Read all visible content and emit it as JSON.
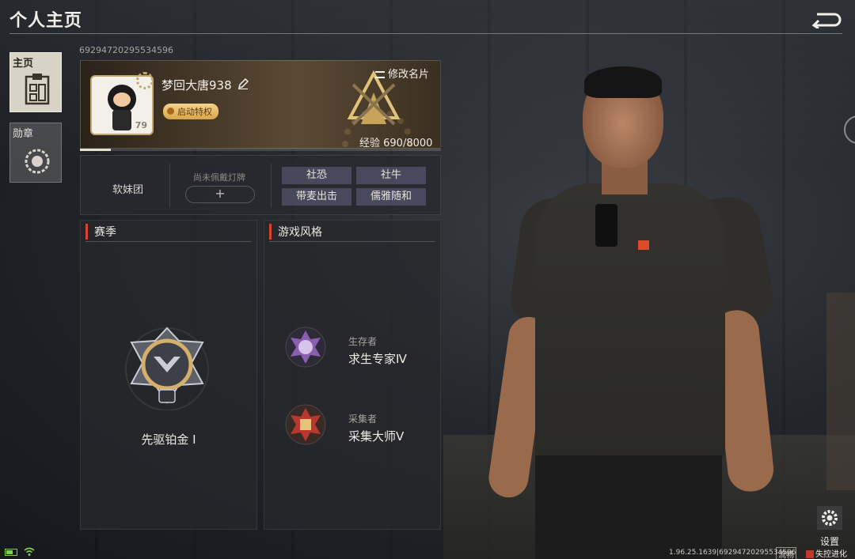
{
  "header": {
    "title": "个人主页"
  },
  "tabs": [
    {
      "label": "主页",
      "active": true
    },
    {
      "label": "勋章",
      "active": false
    }
  ],
  "profile": {
    "uid": "69294720295534596",
    "nickname": "梦回大唐938",
    "avatar_level": "79",
    "privilege_label": "启动特权",
    "edit_card_label": "修改名片",
    "exp_text": "经验 690/8000",
    "exp_current": 690,
    "exp_max": 8000
  },
  "tags_row": {
    "team": "软妹团",
    "lamp_label": "尚未佩戴灯牌",
    "lamp_add": "+",
    "tags": [
      "社恐",
      "社牛",
      "带麦出击",
      "儒雅随和"
    ]
  },
  "season": {
    "title": "赛季",
    "rank_name": "先驱铂金 Ⅰ"
  },
  "game_style": {
    "title": "游戏风格",
    "items": [
      {
        "role": "生存者",
        "name": "求生专家Ⅳ",
        "icon": "survivor-badge-icon"
      },
      {
        "role": "采集者",
        "name": "采集大师Ⅴ",
        "icon": "gatherer-badge-icon"
      }
    ]
  },
  "footer": {
    "settings_label": "设置",
    "version": "1.96.25.1639|69294720295534596",
    "fluency": "流畅",
    "brand": "失控进化"
  },
  "colors": {
    "accent_red": "#d9442f",
    "gold": "#c3a66c",
    "tag_bg": "#6e6e96"
  }
}
